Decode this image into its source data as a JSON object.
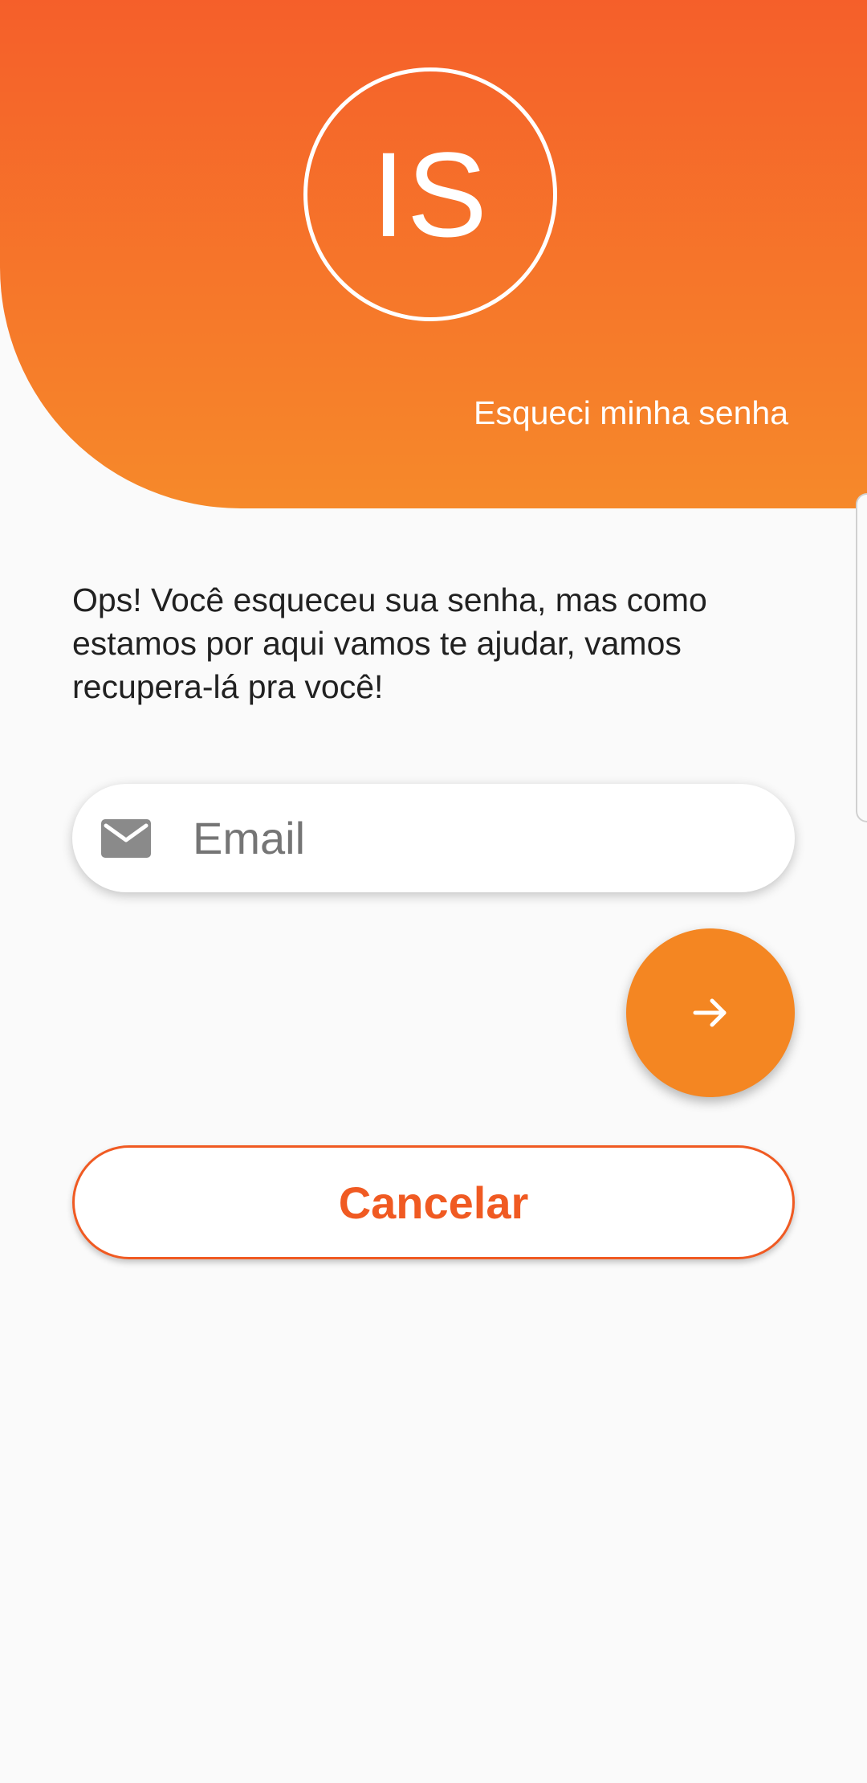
{
  "header": {
    "logo_text": "IS",
    "title": "Esqueci minha senha"
  },
  "message": "Ops! Você esqueceu sua senha, mas como estamos por aqui vamos te ajudar, vamos recupera-lá pra você!",
  "email_field": {
    "icon": "mail-icon",
    "placeholder": "Email",
    "value": ""
  },
  "submit_button": {
    "icon": "arrow-right-icon"
  },
  "cancel_button": {
    "label": "Cancelar"
  },
  "colors": {
    "gradient_top": "#f55f2a",
    "gradient_bottom": "#f6892a",
    "accent": "#f48622",
    "cancel": "#f05a22",
    "background": "#fafafa"
  }
}
